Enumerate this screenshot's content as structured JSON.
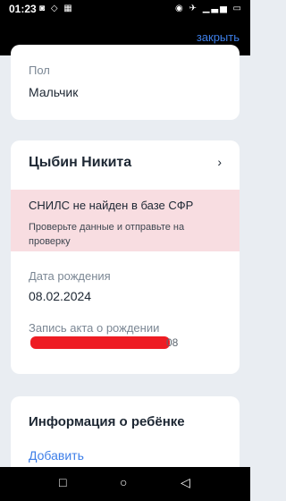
{
  "status_bar": {
    "time": "01:23",
    "left_icons": "◙ ◇ ▦",
    "right_icons": "◉ ✈ ▁▃▅ ▭"
  },
  "top_bar": {
    "close_label": "закрыть"
  },
  "card_gender": {
    "label": "Пол",
    "value": "Мальчик"
  },
  "card_child": {
    "name": "Цыбин Никита",
    "chevron": "›",
    "error": {
      "title": "СНИЛС не найден в базе СФР",
      "subtitle": "Проверьте данные и отправьте на проверку"
    },
    "birth_date_label": "Дата рождения",
    "birth_date_value": "08.02.2024",
    "birth_record_label": "Запись акта о рождении",
    "birth_record_tail": "08"
  },
  "card_info": {
    "title": "Информация о ребёнке",
    "add_label": "Добавить"
  },
  "nav_bar": {
    "square": "□",
    "circle": "○",
    "back": "◁"
  }
}
